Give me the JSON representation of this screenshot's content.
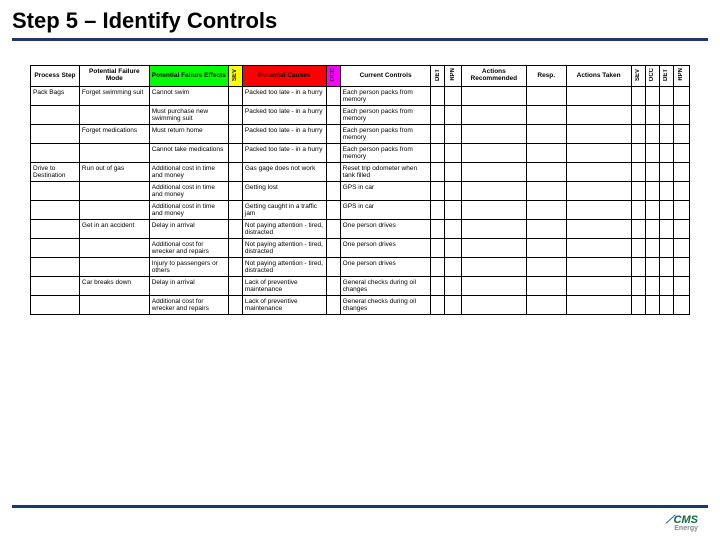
{
  "title": "Step 5 – Identify Controls",
  "logo": {
    "brand": "CMS",
    "sub": "Energy"
  },
  "headers": {
    "process_step": "Process Step",
    "failure_mode": "Potential Failure Mode",
    "failure_effects": "Potential Failure Effects",
    "sev": "SEV",
    "causes": "Potential Causes",
    "occ": "OCC",
    "controls": "Current Controls",
    "det": "DET",
    "rpn": "RPN",
    "actions": "Actions Recommended",
    "resp": "Resp.",
    "actions_taken": "Actions Taken",
    "sev2": "SEV",
    "occ2": "OCC",
    "det2": "DET",
    "rpn2": "RPN"
  },
  "rows": [
    {
      "step": "Pack Bags",
      "mode": "Forget swimming suit",
      "effect": "Cannot swim",
      "cause": "Packed too late - in a hurry",
      "control": "Each person packs from memory"
    },
    {
      "step": "",
      "mode": "",
      "effect": "Must purchase new swimming suit",
      "cause": "Packed too late - in a hurry",
      "control": "Each person packs from memory"
    },
    {
      "step": "",
      "mode": "Forget medications",
      "effect": "Must return home",
      "cause": "Packed too late - in a hurry",
      "control": "Each person packs from memory"
    },
    {
      "step": "",
      "mode": "",
      "effect": "Cannot take medications",
      "cause": "Packed too late - in a hurry",
      "control": "Each person packs from memory"
    },
    {
      "step": "Drive to Destination",
      "mode": "Run out of gas",
      "effect": "Additional cost in time and money",
      "cause": "Gas gage does not work",
      "control": "Reset trip odometer when tank filled"
    },
    {
      "step": "",
      "mode": "",
      "effect": "Additional cost in time and money",
      "cause": "Getting lost",
      "control": "GPS in car"
    },
    {
      "step": "",
      "mode": "",
      "effect": "Additional cost in time and money",
      "cause": "Getting caught in a traffic jam",
      "control": "GPS in car"
    },
    {
      "step": "",
      "mode": "Get in an accident",
      "effect": "Delay in arrival",
      "cause": "Not paying attention - tired, distracted",
      "control": "One person drives"
    },
    {
      "step": "",
      "mode": "",
      "effect": "Additional cost for wrecker and repairs",
      "cause": "Not paying attention - tired, distracted",
      "control": "One person drives"
    },
    {
      "step": "",
      "mode": "",
      "effect": "Injury to passengers or others",
      "cause": "Not paying attention - tired, distracted",
      "control": "One person drives"
    },
    {
      "step": "",
      "mode": "Car breaks down",
      "effect": "Delay in arrival",
      "cause": "Lack of preventive maintenance",
      "control": "General checks during oil changes"
    },
    {
      "step": "",
      "mode": "",
      "effect": "Additional cost for wrecker and repairs",
      "cause": "Lack of preventive maintenance",
      "control": "General checks during oil changes"
    }
  ]
}
